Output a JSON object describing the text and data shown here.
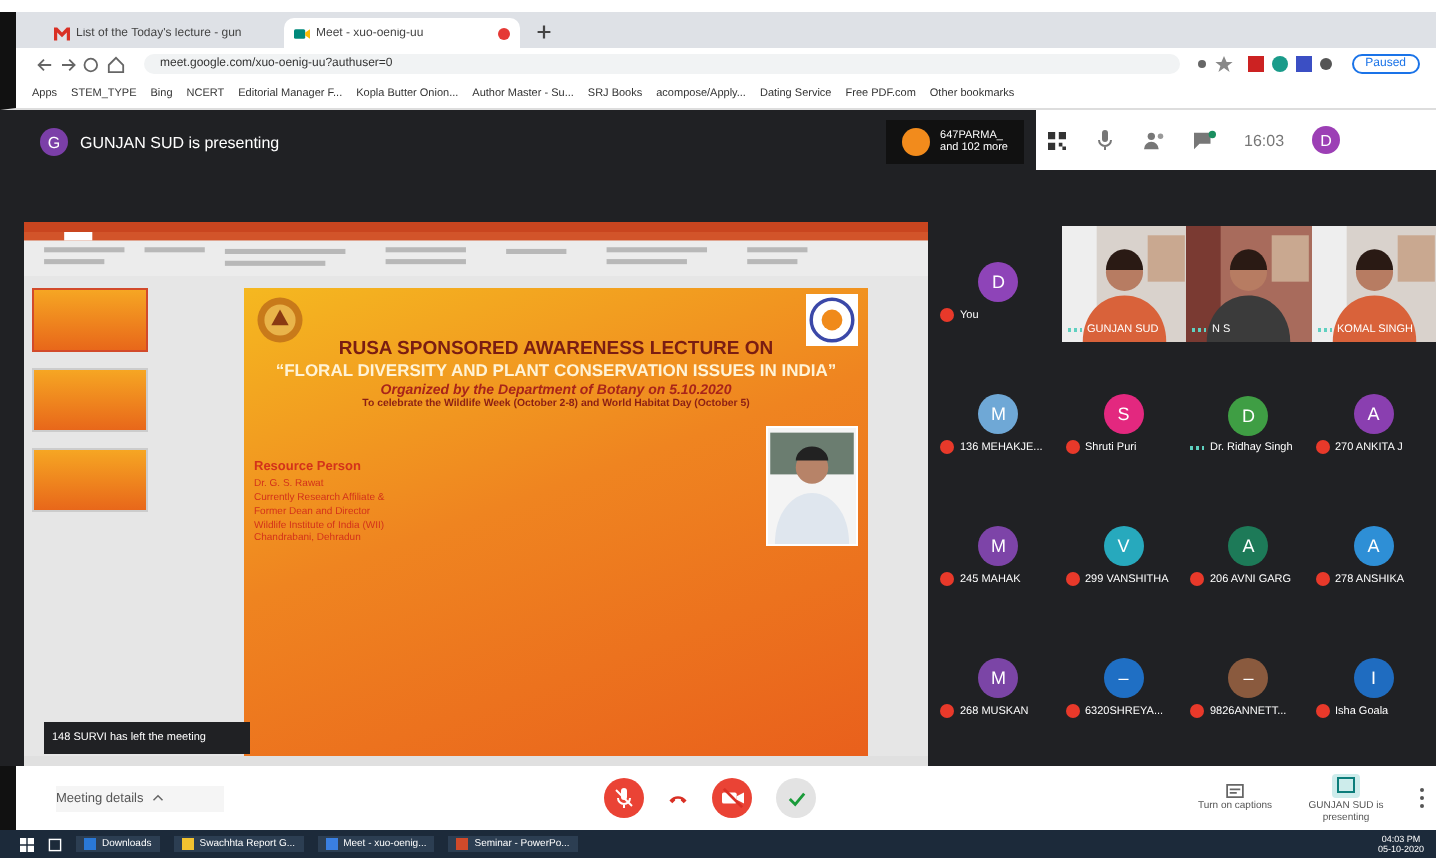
{
  "browser": {
    "tabs": [
      {
        "title": "List of the Today's lecture - gun",
        "selected": false,
        "kind": "mail"
      },
      {
        "title": "Meet - xuo-oenig-uu",
        "selected": true,
        "kind": "meet"
      }
    ],
    "address": "meet.google.com/xuo-oenig-uu?authuser=0",
    "profile": "Paused",
    "bookmarks": [
      "Apps",
      "STEM_TYPE",
      "Bing",
      "NCERT",
      "Editorial Manager F...",
      "Kopla Butter Onion...",
      "Author Master - Su...",
      "SRJ Books",
      "acompose/Apply...",
      "Dating Service",
      "Free PDF.com",
      "Other bookmarks"
    ]
  },
  "meet": {
    "presenter": {
      "initial": "G",
      "text": "GUNJAN SUD is presenting"
    },
    "others": {
      "name": "647PARMA_",
      "more": "and 102 more"
    },
    "time": "16:03",
    "self_initial": "D",
    "presentation": {
      "slide": {
        "title": "RUSA SPONSORED AWARENESS LECTURE ON",
        "subtitle": "“FLORAL DIVERSITY AND PLANT CONSERVATION ISSUES IN INDIA”",
        "organized": "Organized by the Department of Botany on 5.10.2020",
        "celebrate": "To celebrate the Wildlife Week (October 2-8) and World Habitat Day (October 5)",
        "resource_heading": "Resource Person",
        "resource_lines": [
          "Dr. G. S. Rawat",
          "Currently Research Affiliate &",
          "Former Dean and Director",
          "Wildlife Institute of India (WII)",
          "Chandrabani, Dehradun"
        ]
      },
      "thumbnails": [
        {
          "selected": true
        },
        {
          "selected": false
        },
        {
          "selected": false
        }
      ]
    },
    "toast": "148 SURVI has left the meeting",
    "participants": [
      {
        "kind": "avatar",
        "initial": "D",
        "color": "#8e44b8",
        "name": "You",
        "muted": true
      },
      {
        "kind": "video",
        "name": "GUNJAN SUD",
        "muted": false
      },
      {
        "kind": "video",
        "name": "N S",
        "muted": false
      },
      {
        "kind": "video",
        "name": "KOMAL SINGH",
        "muted": false
      },
      {
        "kind": "avatar",
        "initial": "M",
        "color": "#6fa8d6",
        "name": "136 MEHAKJE...",
        "muted": true
      },
      {
        "kind": "avatar",
        "initial": "S",
        "color": "#e3287f",
        "name": "Shruti Puri",
        "muted": true
      },
      {
        "kind": "avatar",
        "initial": "D",
        "color": "#3f9e44",
        "name": "Dr. Ridhay Singh",
        "muted": false
      },
      {
        "kind": "avatar",
        "initial": "A",
        "color": "#8a3fb0",
        "name": "270 ANKITA J",
        "muted": true
      },
      {
        "kind": "avatar",
        "initial": "M",
        "color": "#7d44a8",
        "name": "245 MAHAK",
        "muted": true
      },
      {
        "kind": "avatar",
        "initial": "V",
        "color": "#27a9bd",
        "name": "299 VANSHITHA",
        "muted": true
      },
      {
        "kind": "avatar",
        "initial": "A",
        "color": "#1d7a58",
        "name": "206 AVNI GARG",
        "muted": true
      },
      {
        "kind": "avatar",
        "initial": "A",
        "color": "#2e8fd6",
        "name": "278 ANSHIKA",
        "muted": true
      },
      {
        "kind": "avatar",
        "initial": "M",
        "color": "#7b45a6",
        "name": "268 MUSKAN",
        "muted": true
      },
      {
        "kind": "avatar",
        "initial": "–",
        "color": "#1f6fc4",
        "name": "6320SHREYA...",
        "muted": true
      },
      {
        "kind": "avatar",
        "initial": "–",
        "color": "#8a5a3e",
        "name": "9826ANNETT...",
        "muted": true
      },
      {
        "kind": "avatar",
        "initial": "I",
        "color": "#1f6cc0",
        "name": "Isha Goala",
        "muted": true
      }
    ],
    "controls": {
      "meeting_details": "Meeting details",
      "mic_on": false,
      "camera_on": false,
      "captions": "Turn on captions",
      "presenting": "GUNJAN SUD is presenting"
    }
  },
  "taskbar": {
    "items": [
      "Downloads",
      "Swachhta Report G...",
      "Meet - xuo-oenig...",
      "Seminar - PowerPo..."
    ],
    "time": "04:03 PM",
    "date": "05-10-2020"
  }
}
